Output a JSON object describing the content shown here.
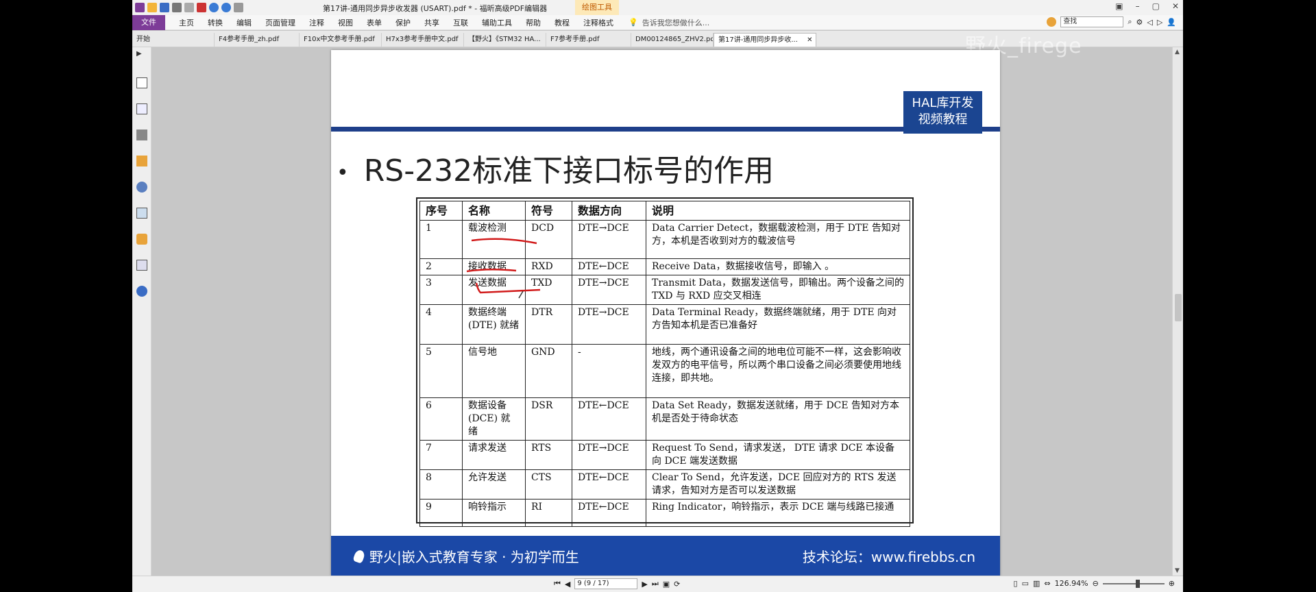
{
  "app": {
    "title": "第17讲-通用同步异步收发器 (USART).pdf * - 福昕高级PDF编辑器",
    "context_tab": "绘图工具"
  },
  "menu": {
    "file": "文件",
    "items": [
      "主页",
      "转换",
      "编辑",
      "页面管理",
      "注释",
      "视图",
      "表单",
      "保护",
      "共享",
      "互联",
      "辅助工具",
      "帮助",
      "教程",
      "注释格式"
    ],
    "hint": "告诉我您想做什么...",
    "search_placeholder": "查找"
  },
  "tabs": [
    {
      "label": "开始"
    },
    {
      "label": "F4参考手册_zh.pdf"
    },
    {
      "label": "F10x中文参考手册.pdf"
    },
    {
      "label": "H7x3参考手册中文.pdf"
    },
    {
      "label": "【野火】《STM32 HA..."
    },
    {
      "label": "F7参考手册.pdf"
    },
    {
      "label": "DM00124865_ZHV2.pdf"
    },
    {
      "label": "第17讲-通用同步异步收..."
    }
  ],
  "watermark": "野火_firege",
  "slide": {
    "badge_line1": "HAL库开发",
    "badge_line2": "视频教程",
    "bullet": "•",
    "title": "RS-232标准下接口标号的作用",
    "table": {
      "headers": [
        "序号",
        "名称",
        "符号",
        "数据方向",
        "说明"
      ],
      "rows": [
        [
          "1",
          "载波检测",
          "DCD",
          "DTE→DCE",
          "Data Carrier Detect，数据载波检测，用于 DTE 告知对方，本机是否收到对方的载波信号"
        ],
        [
          "2",
          "接收数据",
          "RXD",
          "DTE←DCE",
          "Receive Data，数据接收信号，即输入 。"
        ],
        [
          "3",
          "发送数据",
          "TXD",
          "DTE→DCE",
          "Transmit Data，数据发送信号，即输出。两个设备之间的 TXD 与 RXD 应交叉相连"
        ],
        [
          "4",
          "数据终端 (DTE) 就绪",
          "DTR",
          "DTE→DCE",
          "Data Terminal Ready，数据终端就绪，用于 DTE 向对方告知本机是否已准备好"
        ],
        [
          "5",
          "信号地",
          "GND",
          "-",
          "地线，两个通讯设备之间的地电位可能不一样，这会影响收发双方的电平信号，所以两个串口设备之间必须要使用地线连接，即共地。"
        ],
        [
          "6",
          "数据设备 (DCE) 就绪",
          "DSR",
          "DTE←DCE",
          "Data Set Ready，数据发送就绪，用于 DCE 告知对方本机是否处于待命状态"
        ],
        [
          "7",
          "请求发送",
          "RTS",
          "DTE→DCE",
          "Request To Send，请求发送， DTE 请求 DCE 本设备向 DCE 端发送数据"
        ],
        [
          "8",
          "允许发送",
          "CTS",
          "DTE←DCE",
          "Clear To Send，允许发送，DCE 回应对方的 RTS 发送请求，告知对方是否可以发送数据"
        ],
        [
          "9",
          "响铃指示",
          "RI",
          "DTE←DCE",
          "Ring Indicator，响铃指示，表示 DCE 端与线路已接通"
        ]
      ]
    },
    "footer_left": "野火|嵌入式教育专家 · 为初学而生",
    "footer_right": "技术论坛：www.firebbs.cn"
  },
  "status": {
    "page_indicator": "9 (9 / 17)",
    "zoom": "126.94%"
  },
  "colors": {
    "accent_blue": "#1b48a6",
    "file_purple": "#7d3c98",
    "annotation_red": "#d11a1a"
  }
}
